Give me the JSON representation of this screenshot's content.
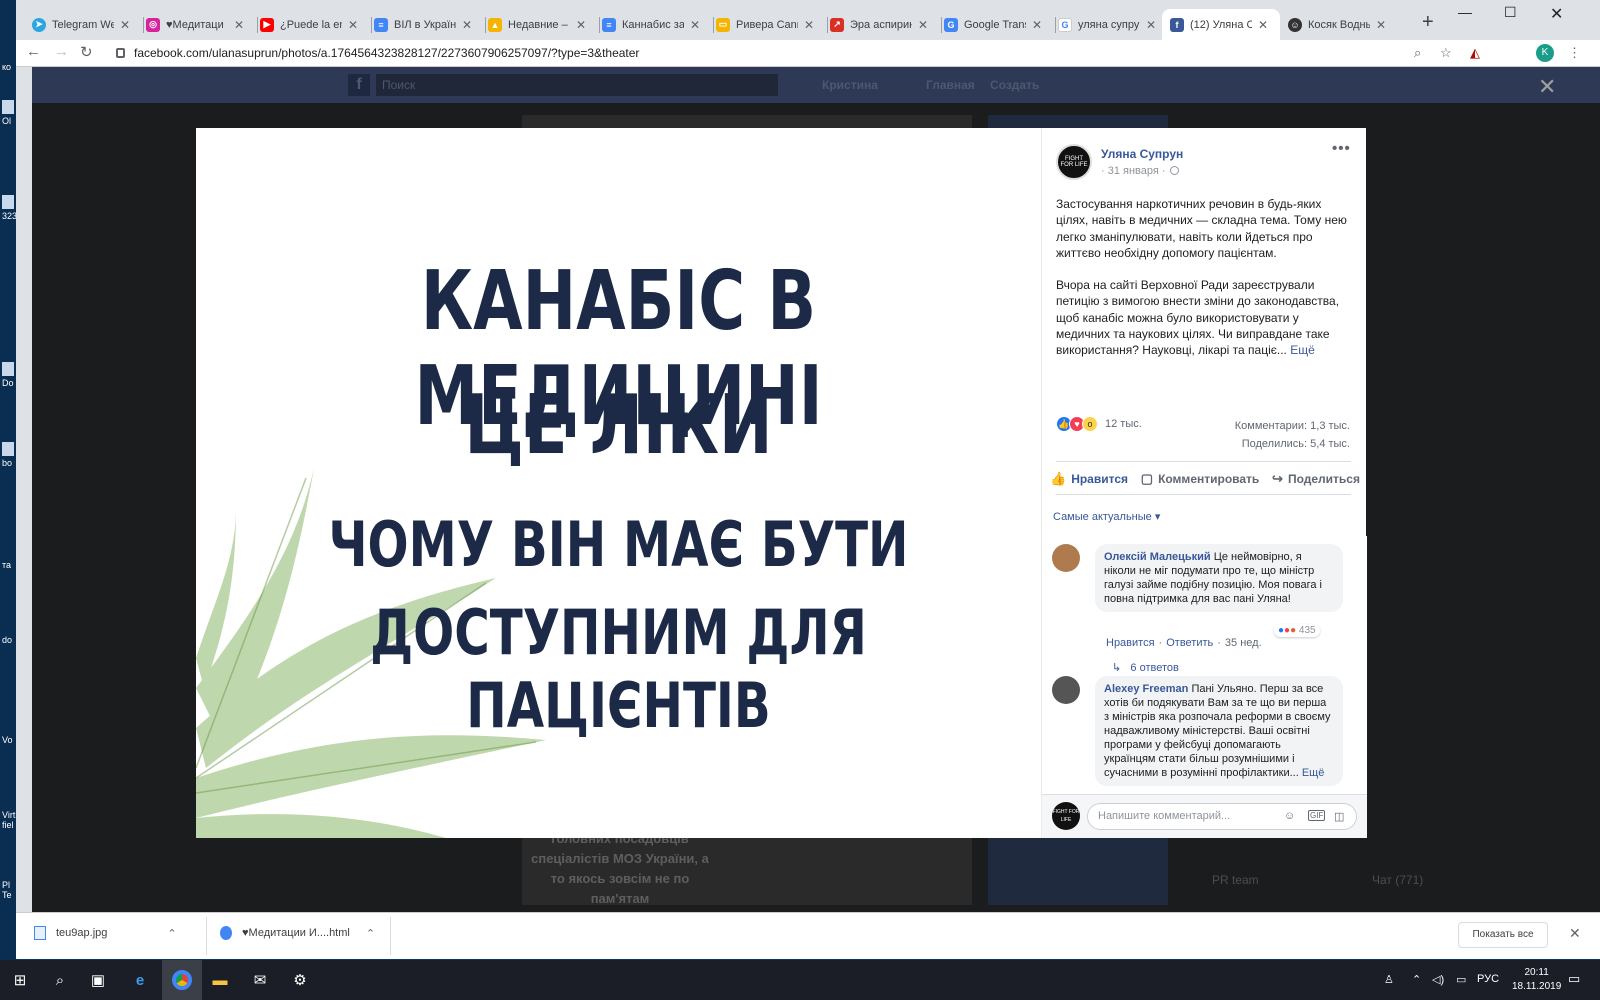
{
  "desktop": {
    "items": [
      "ко",
      "Ol",
      "323",
      "Do",
      "bo",
      "та",
      "do",
      "Vo",
      "Virt fiel",
      "Pl Te"
    ]
  },
  "browser": {
    "tabs": [
      {
        "label": "Telegram Web",
        "icon": "telegram-icon",
        "color": "#2ca5e0"
      },
      {
        "label": "♥Медитаци",
        "icon": "instagram-icon",
        "color": "#d6249f"
      },
      {
        "label": "¿Puede la env",
        "icon": "youtube-icon",
        "color": "#ff0000"
      },
      {
        "label": "ВІЛ в Україні",
        "icon": "docs-icon",
        "color": "#4285f4"
      },
      {
        "label": "Недавние – G",
        "icon": "drive-icon",
        "color": "#f4b400"
      },
      {
        "label": "Каннабис зап",
        "icon": "docs-icon",
        "color": "#4285f4"
      },
      {
        "label": "Ривера Canna",
        "icon": "slides-icon",
        "color": "#f4b400"
      },
      {
        "label": "Эра аспирина",
        "icon": "chart-icon",
        "color": "#d93025"
      },
      {
        "label": "Google Transl",
        "icon": "translate-icon",
        "color": "#4285f4"
      },
      {
        "label": "уляна супрун",
        "icon": "google-icon",
        "color": "#4285f4"
      },
      {
        "label": "(12) Уляна Су",
        "icon": "facebook-icon",
        "color": "#3b5998"
      },
      {
        "label": "Косяк Водный",
        "icon": "cannabis-icon",
        "color": "#333333"
      }
    ],
    "url": "facebook.com/ulanasuprun/photos/a.1764564323828127/2273607906257097/?type=3&theater",
    "profile_initial": "K"
  },
  "fb": {
    "search_placeholder": "Поиск",
    "nav": [
      "Кристина",
      "Главная",
      "Создать"
    ],
    "bg_text": "головних посадовців спеціалістів МОЗ України, а то якось зовсім не по пам'ятам",
    "chat_group": "PR team",
    "chat_label": "Чат (771)"
  },
  "photo": {
    "line1": "КАНАБІС В МЕДИЦИНІ",
    "line2": "ЦЕ ЛІКИ",
    "line3": "ЧОМУ ВІН МАЄ БУТИ",
    "line4": "ДОСТУПНИМ ДЛЯ ПАЦІЄНТІВ"
  },
  "post": {
    "author": "Уляна Супрун",
    "avatar_text": "FIGHT FOR LIFE",
    "date": "· 31 января ·",
    "para1": "Застосування наркотичних речовин в будь-яких цілях, навіть в медичних — складна тема. Тому нею легко зманіпулювати, навіть коли йдеться про життєво необхідну допомогу пацієнтам.",
    "para2": "Вчора на сайті Верховної Ради зареєстрували петицію з вимогою внести зміни до законодавства, щоб канабіс можна було використовувати у медичних та наукових цілях. Чи виправдане таке використання? Науковці, лікарі та паціє...",
    "see_more": "Ещё",
    "reactions_count": "12 тыс.",
    "comments_stat": "Комментарии: 1,3 тыс.",
    "shares_stat": "Поделились: 5,4 тыс.",
    "like_label": "Нравится",
    "comment_label": "Комментировать",
    "share_label": "Поделиться",
    "sort_label": "Самые актуальные"
  },
  "comments": [
    {
      "name": "Олексій Малецький",
      "text": "Це неймовірно, я ніколи не міг подумати про те, що міністр галузі займе подібну позицію. Моя повага і повна підтримка для вас пані Уляна!",
      "like": "Нравится",
      "reply": "Ответить",
      "time": "35 нед.",
      "react_count": "435",
      "replies": "6 ответов"
    },
    {
      "name": "Alexey Freeman",
      "text": "Пані Ульяно. Перш за все хотів би подякувати Вам за те що ви перша з міністрів яка розпочала реформи в своєму надважливому міністерстві. Ваші освітні програми у фейсбуці допомагають українцям стати більш розумнішими і сучасними в розумінні профілактики...",
      "see_more": "Ещё"
    }
  ],
  "compose": {
    "placeholder": "Напишите комментарий...",
    "avatar_text": "FIGHT FOR LIFE"
  },
  "downloads": {
    "items": [
      "teu9ap.jpg",
      "♥Медитации И....html"
    ],
    "show_all": "Показать все"
  },
  "taskbar": {
    "lang": "РУС",
    "time": "20:11",
    "date": "18.11.2019"
  }
}
